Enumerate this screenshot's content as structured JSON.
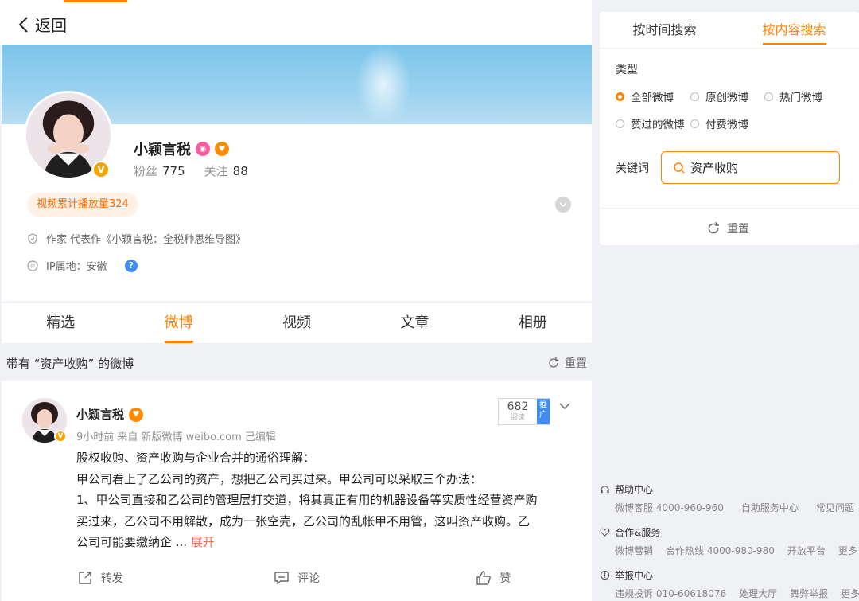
{
  "nav": {
    "back_label": "返回"
  },
  "profile": {
    "name": "小颖言税",
    "fans_label": "粉丝",
    "fans_count": "775",
    "follow_label": "关注",
    "follow_count": "88",
    "play_badge": "视频累计播放量324",
    "occupation": "作家 代表作《小颖言税：全税种思维导图》",
    "ip_location": "IP属地：安徽",
    "help_icon": "?"
  },
  "tabs": [
    {
      "label": "精选"
    },
    {
      "label": "微博"
    },
    {
      "label": "视频"
    },
    {
      "label": "文章"
    },
    {
      "label": "相册"
    }
  ],
  "active_tab": "微博",
  "filter": {
    "text": "带有 “资产收购” 的微博",
    "reset_label": "重置"
  },
  "post": {
    "author": "小颖言税",
    "meta": "9小时前  来自 新版微博 weibo.com 已编辑",
    "reads": "682",
    "reads_label": "阅读",
    "promo_label": "推广",
    "lines": [
      "股权收购、资产收购与企业合并的通俗理解：",
      "甲公司看上了乙公司的资产，想把乙公司买过来。甲公司可以采取三个办法：",
      "1、甲公司直接和乙公司的管理层打交道，将其真正有用的机器设备等实质性经营资产购",
      "买过来，乙公司不用解散，成为一张空壳，乙公司的乱帐甲不用管，这叫资产收购。乙",
      "公司可能要缴纳企  ... "
    ],
    "expand_label": "展开",
    "actions": {
      "repost": "转发",
      "comment": "评论",
      "like": "赞"
    }
  },
  "search_panel": {
    "tab_time": "按时间搜索",
    "tab_content": "按内容搜索",
    "type_label": "类型",
    "options": [
      {
        "label": "全部微博",
        "selected": true
      },
      {
        "label": "原创微博",
        "selected": false
      },
      {
        "label": "热门微博",
        "selected": false
      },
      {
        "label": "赞过的微博",
        "selected": false
      },
      {
        "label": "付费微博",
        "selected": false
      }
    ],
    "keyword_label": "关键词",
    "keyword_value": "资产收购",
    "reset_label": "重置"
  },
  "footer": {
    "help": {
      "title": "帮助中心",
      "links": [
        "微博客服 4000-960-960",
        "自助服务中心",
        "常见问题"
      ]
    },
    "coop": {
      "title": "合作&服务",
      "links": [
        "微博营销",
        "合作热线 4000-980-980",
        "开放平台",
        "更多"
      ]
    },
    "report": {
      "title": "举报中心",
      "links": [
        "违规投诉 010-60618076",
        "处理大厅",
        "舞弊举报",
        "更多"
      ]
    }
  },
  "colors": {
    "accent": "#ff8200",
    "link": "#eb7350",
    "verified": "#f6a400",
    "blue": "#3d8ef0"
  }
}
